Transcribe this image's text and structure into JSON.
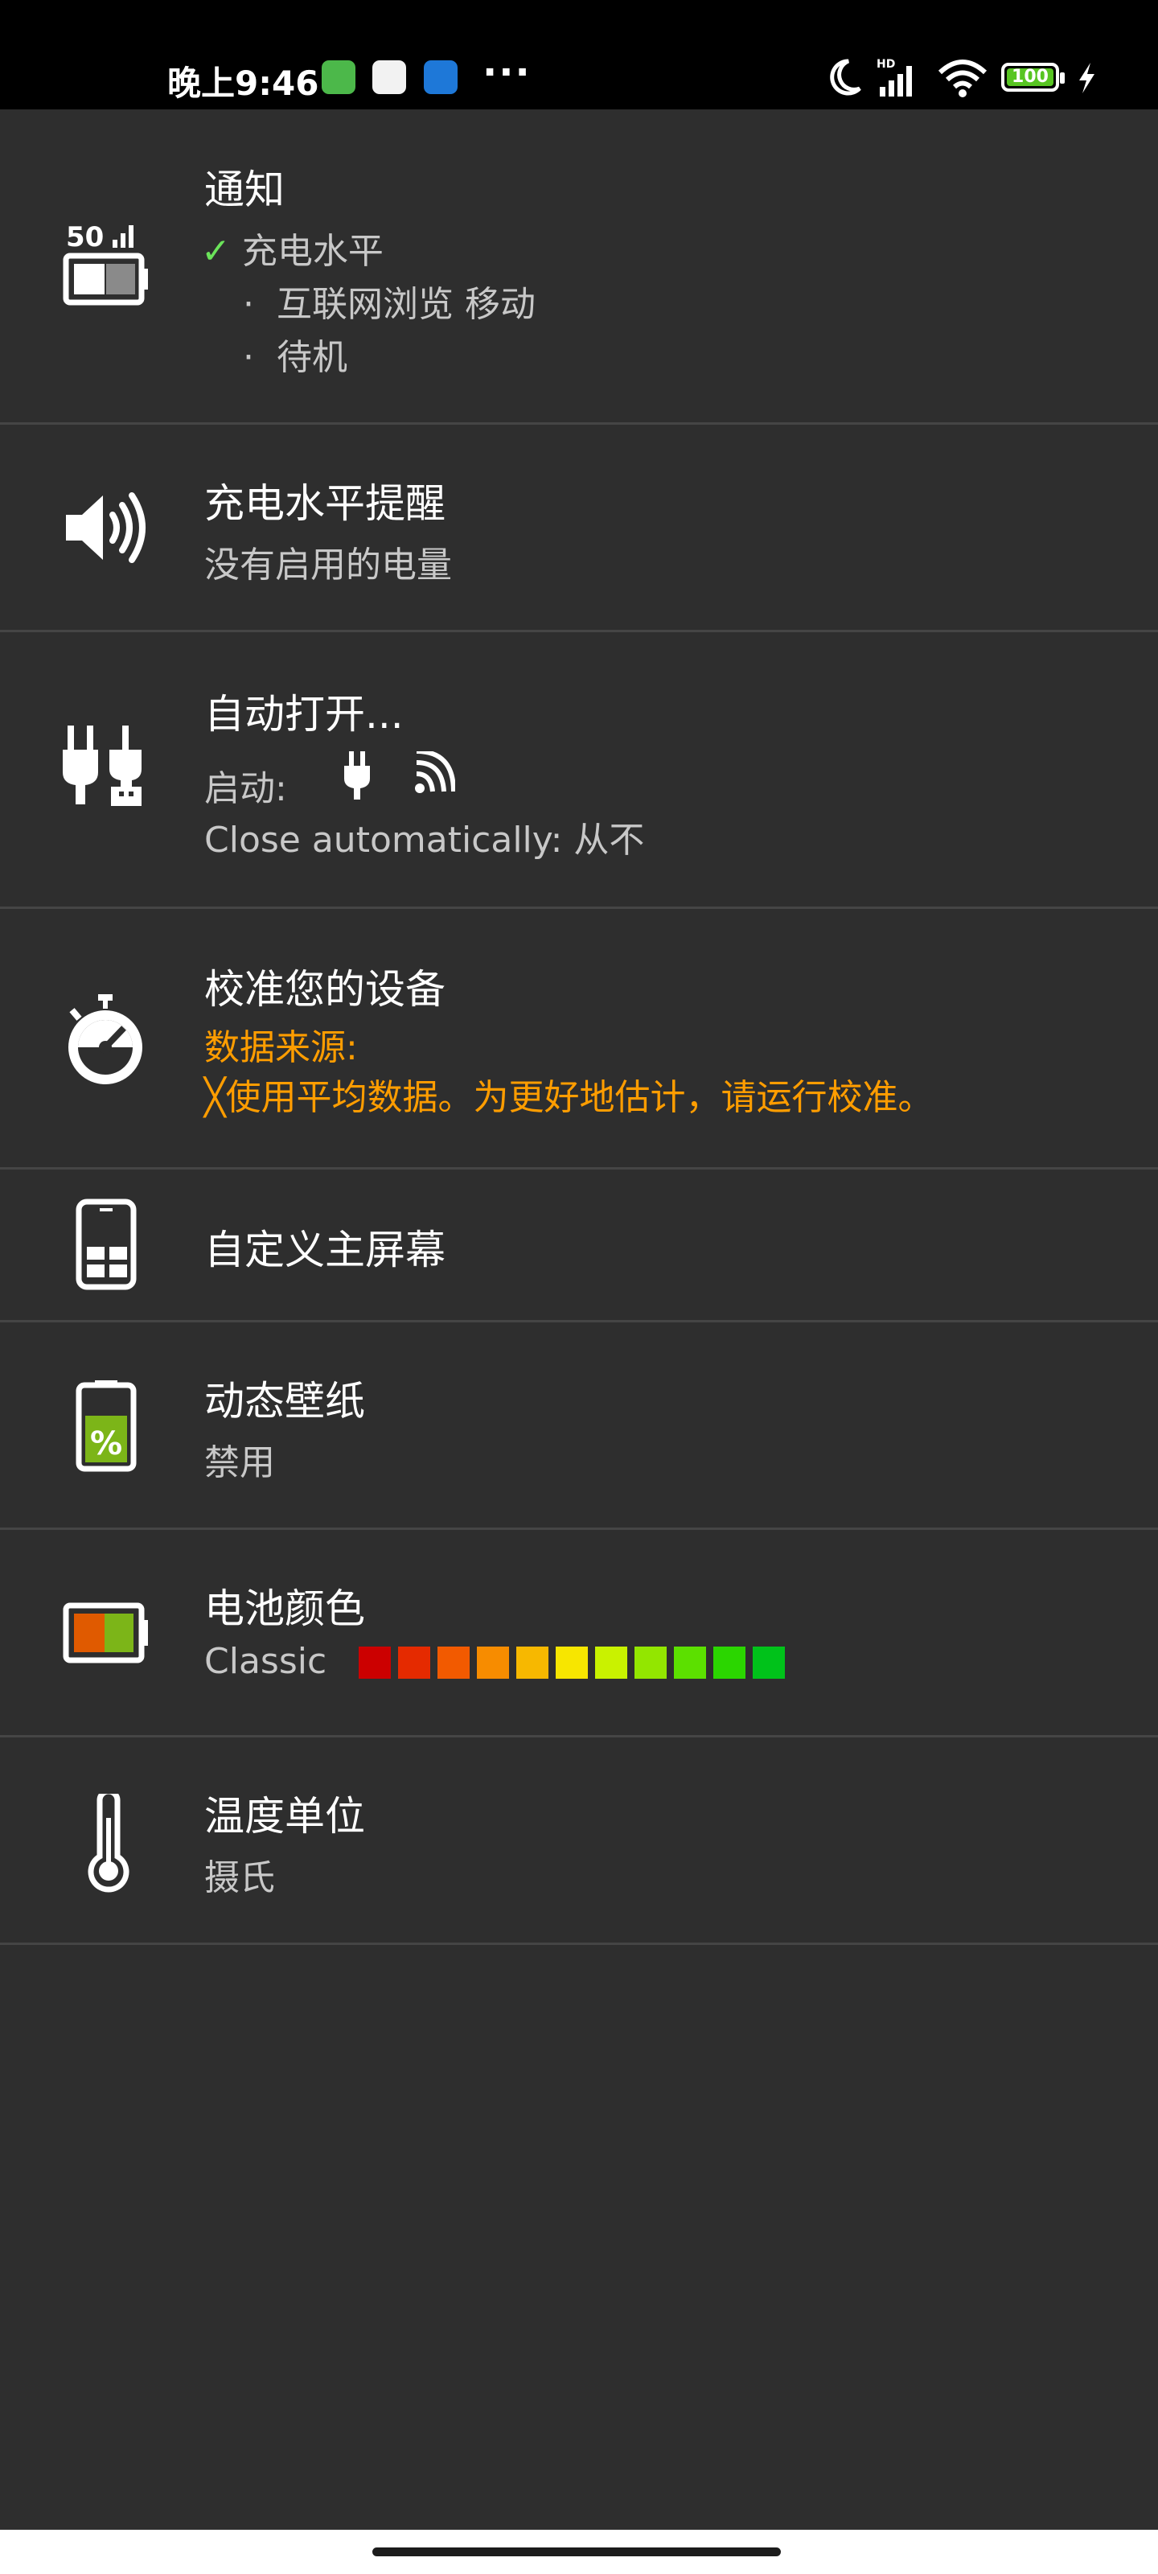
{
  "status_bar": {
    "time": "晚上9:46",
    "overflow": "···",
    "battery": "100",
    "icons": [
      "app-icon-green",
      "app-icon-white",
      "app-icon-blue",
      "moon-icon",
      "hd-signal-icon",
      "wifi-icon",
      "battery-icon",
      "charging-bolt-icon"
    ]
  },
  "settings": {
    "notification": {
      "title": "通知",
      "check": "✓",
      "checked_item": "充电水平",
      "bullet": "·",
      "items": [
        "互联网浏览 移动",
        "待机"
      ],
      "icon": "battery-signal-icon",
      "icon_text": "50"
    },
    "charge_alert": {
      "title": "充电水平提醒",
      "subtitle": "没有启用的电量",
      "icon": "speaker-icon"
    },
    "auto_open": {
      "title": "自动打开...",
      "start_label": "启动:",
      "close_label": "Close automatically: 从不",
      "icon": "plugs-icon"
    },
    "calibrate": {
      "title": "校准您的设备",
      "source_label": "数据来源:",
      "warning_mark": "╳",
      "warning": "使用平均数据。为更好地估计，请运行校准。",
      "icon": "stopwatch-icon"
    },
    "home_screen": {
      "title": "自定义主屏幕",
      "icon": "phone-widget-icon"
    },
    "live_wallpaper": {
      "title": "动态壁纸",
      "subtitle": "禁用",
      "icon": "battery-percent-icon",
      "icon_text": "%"
    },
    "battery_color": {
      "title": "电池颜色",
      "subtitle": "Classic",
      "icon": "battery-color-icon",
      "swatches": [
        "#cc0000",
        "#e52a00",
        "#f25a00",
        "#f78c00",
        "#f7b800",
        "#f7e600",
        "#c9f200",
        "#93e600",
        "#5ce000",
        "#2bd600",
        "#00c21a"
      ]
    },
    "temperature": {
      "title": "温度单位",
      "subtitle": "摄氏",
      "icon": "thermometer-icon"
    }
  },
  "colors": {
    "background": "#2e2e2e",
    "divider": "#454545",
    "warning": "#ff9d00",
    "check": "#6be35a"
  }
}
